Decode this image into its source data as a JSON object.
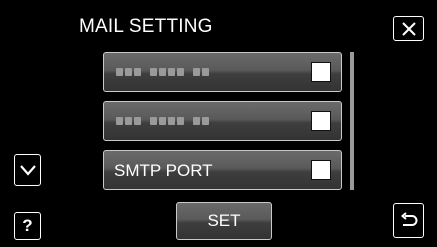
{
  "header": {
    "title": "MAIL SETTING",
    "close_icon": "close-x-icon"
  },
  "list": {
    "items": [
      {
        "label": "",
        "masked": true,
        "checked": false
      },
      {
        "label": "",
        "masked": true,
        "checked": false
      },
      {
        "label": "SMTP PORT",
        "masked": false,
        "checked": false
      }
    ],
    "scroll_down_icon": "chevron-down-icon"
  },
  "footer": {
    "help_label": "?",
    "set_label": "SET",
    "back_icon": "return-arrow-icon"
  },
  "colors": {
    "background": "#000000",
    "button_border": "#c9c9c9",
    "text": "#ffffff"
  }
}
